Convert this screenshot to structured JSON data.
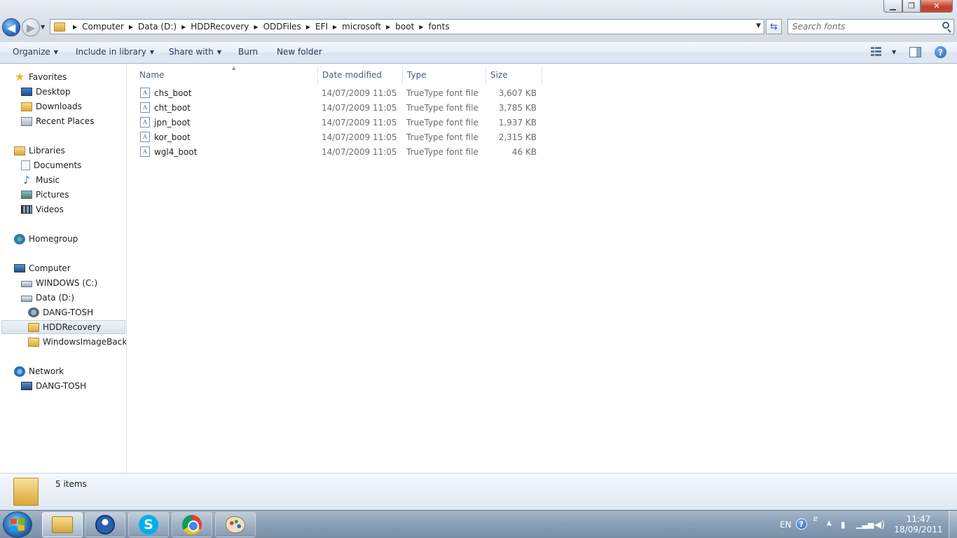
{
  "window": {
    "minimize": "▁",
    "maximize": "❐",
    "close": "✕"
  },
  "address": {
    "breadcrumbs": [
      "Computer",
      "Data (D:)",
      "HDDRecovery",
      "ODDFiles",
      "EFI",
      "microsoft",
      "boot",
      "fonts"
    ],
    "search_placeholder": "Search fonts"
  },
  "toolbar": {
    "organize": "Organize",
    "include_in_library": "Include in library",
    "share_with": "Share with",
    "burn": "Burn",
    "new_folder": "New folder"
  },
  "nav": {
    "favorites": "Favorites",
    "desktop": "Desktop",
    "downloads": "Downloads",
    "recent_places": "Recent Places",
    "libraries": "Libraries",
    "documents": "Documents",
    "music": "Music",
    "pictures": "Pictures",
    "videos": "Videos",
    "homegroup": "Homegroup",
    "computer": "Computer",
    "windows_c": "WINDOWS (C:)",
    "data_d": "Data (D:)",
    "dang_tosh_drive": "DANG-TOSH",
    "hddrecovery": "HDDRecovery",
    "windowsimagebackup": "WindowsImageBackup",
    "network": "Network",
    "dang_tosh_pc": "DANG-TOSH"
  },
  "columns": {
    "name": "Name",
    "date_modified": "Date modified",
    "type": "Type",
    "size": "Size"
  },
  "files": [
    {
      "name": "chs_boot",
      "date": "14/07/2009 11:05",
      "type": "TrueType font file",
      "size": "3,607 KB"
    },
    {
      "name": "cht_boot",
      "date": "14/07/2009 11:05",
      "type": "TrueType font file",
      "size": "3,785 KB"
    },
    {
      "name": "jpn_boot",
      "date": "14/07/2009 11:05",
      "type": "TrueType font file",
      "size": "1,937 KB"
    },
    {
      "name": "kor_boot",
      "date": "14/07/2009 11:05",
      "type": "TrueType font file",
      "size": "2,315 KB"
    },
    {
      "name": "wgl4_boot",
      "date": "14/07/2009 11:05",
      "type": "TrueType font file",
      "size": "46 KB"
    }
  ],
  "details": {
    "item_count": "5 items"
  },
  "taskbar": {
    "language": "EN",
    "time": "11:47",
    "date": "18/09/2011"
  }
}
